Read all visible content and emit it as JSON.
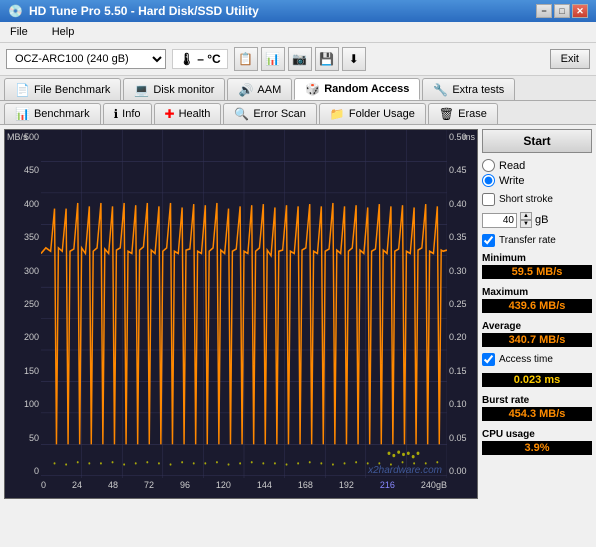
{
  "titleBar": {
    "icon": "💿",
    "title": "HD Tune Pro 5.50 - Hard Disk/SSD Utility",
    "minBtn": "−",
    "maxBtn": "□",
    "closeBtn": "✕"
  },
  "menuBar": {
    "items": [
      "File",
      "Help"
    ]
  },
  "toolbar": {
    "driveOptions": [
      "OCZ-ARC100 (240 gB)"
    ],
    "selectedDrive": "OCZ-ARC100 (240 gB)",
    "tempLabel": "– °C",
    "exitLabel": "Exit"
  },
  "tabs1": [
    {
      "id": "file-benchmark",
      "label": "File Benchmark",
      "icon": "📄"
    },
    {
      "id": "disk-monitor",
      "label": "Disk monitor",
      "icon": "💻"
    },
    {
      "id": "aam",
      "label": "AAM",
      "icon": "🔊"
    },
    {
      "id": "random-access",
      "label": "Random Access",
      "icon": "🎲",
      "active": true
    },
    {
      "id": "extra-tests",
      "label": "Extra tests",
      "icon": "🔧"
    }
  ],
  "tabs2": [
    {
      "id": "benchmark",
      "label": "Benchmark",
      "icon": "📊"
    },
    {
      "id": "info",
      "label": "Info",
      "icon": "ℹ"
    },
    {
      "id": "health",
      "label": "Health",
      "icon": "➕"
    },
    {
      "id": "error-scan",
      "label": "Error Scan",
      "icon": "🔍"
    },
    {
      "id": "folder-usage",
      "label": "Folder Usage",
      "icon": "📁"
    },
    {
      "id": "erase",
      "label": "Erase",
      "icon": "🗑"
    }
  ],
  "chart": {
    "unitLeft": "MB/s",
    "unitRight": "ms",
    "yAxisLeft": [
      "500",
      "450",
      "400",
      "350",
      "300",
      "250",
      "200",
      "150",
      "100",
      "50",
      "0"
    ],
    "yAxisRight": [
      "0.50",
      "0.45",
      "0.40",
      "0.35",
      "0.30",
      "0.25",
      "0.20",
      "0.15",
      "0.10",
      "0.05",
      "0.00"
    ],
    "xAxisLabels": [
      "0",
      "24",
      "48",
      "72",
      "96",
      "120",
      "144",
      "168",
      "192",
      "216",
      "240gB"
    ],
    "watermark": "x2hardware.com"
  },
  "rightPanel": {
    "startLabel": "Start",
    "readLabel": "Read",
    "writeLabel": "Write",
    "shortStrokeLabel": "Short stroke",
    "shortStrokeValue": "40",
    "shortStrokeUnit": "gB",
    "transferRateLabel": "Transfer rate",
    "transferRateChecked": true,
    "minimumLabel": "Minimum",
    "minimumValue": "59.5 MB/s",
    "maximumLabel": "Maximum",
    "maximumValue": "439.6 MB/s",
    "averageLabel": "Average",
    "averageValue": "340.7 MB/s",
    "accessTimeLabel": "Access time",
    "accessTimeChecked": true,
    "accessTimeValue": "0.023 ms",
    "burstRateLabel": "Burst rate",
    "burstRateValue": "454.3 MB/s",
    "cpuUsageLabel": "CPU usage",
    "cpuUsageValue": "3.9%"
  }
}
